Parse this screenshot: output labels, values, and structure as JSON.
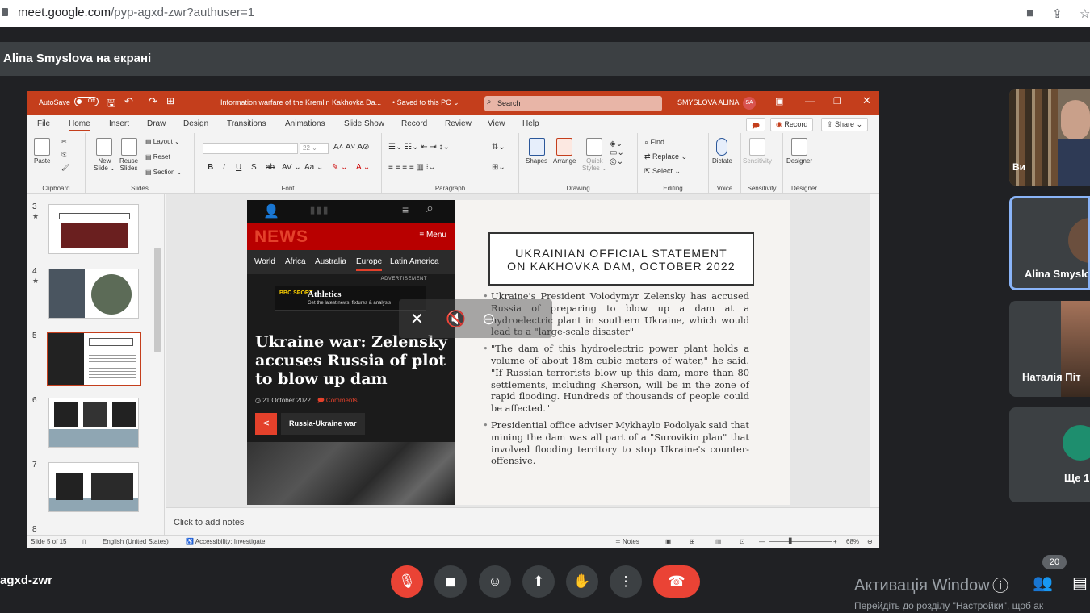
{
  "browser": {
    "url_host": "meet.google.com",
    "url_path": "/pyp-agxd-zwr?authuser=1"
  },
  "meet": {
    "presenter_banner": "Alina Smyslova на екрані",
    "meeting_code": "agxd-zwr",
    "participant_count": "20",
    "participants": [
      {
        "name": "Ви"
      },
      {
        "name": "Alina Smyslo"
      },
      {
        "name": "Наталія Піт"
      },
      {
        "name": "Ще 1"
      }
    ],
    "windows_activation_title": "Активація Window",
    "windows_activation_sub": "Перейдіть до розділу \"Настройки\", щоб ак"
  },
  "ppt": {
    "autosave_label": "AutoSave",
    "autosave_state": "Off",
    "doc_title": "Information warfare of the Kremlin Kakhovka Da...",
    "saved_state": "• Saved to this PC ⌄",
    "search_placeholder": "Search",
    "user_name": "SMYSLOVA ALINA",
    "user_initials": "SA",
    "tabs": [
      "File",
      "Home",
      "Insert",
      "Draw",
      "Design",
      "Transitions",
      "Animations",
      "Slide Show",
      "Record",
      "Review",
      "View",
      "Help"
    ],
    "record_button": "Record",
    "share_button": "Share",
    "ribbon": {
      "paste": "Paste",
      "clipboard": "Clipboard",
      "new_slide": "New",
      "new_slide2": "Slide ⌄",
      "reuse": "Reuse",
      "reuse2": "Slides",
      "layout": "Layout ⌄",
      "reset": "Reset",
      "section": "Section ⌄",
      "slides": "Slides",
      "font_size": "22",
      "font": "Font",
      "paragraph": "Paragraph",
      "shapes": "Shapes",
      "arrange": "Arrange",
      "quick_styles": "Quick",
      "quick_styles2": "Styles ⌄",
      "drawing": "Drawing",
      "find": "Find",
      "replace": "Replace ⌄",
      "select": "Select ⌄",
      "editing": "Editing",
      "dictate": "Dictate",
      "voice": "Voice",
      "sensitivity": "Sensitivity",
      "designer": "Designer"
    },
    "thumbnails": [
      {
        "num": "3",
        "star": "★"
      },
      {
        "num": "4",
        "star": "★"
      },
      {
        "num": "5",
        "star": ""
      },
      {
        "num": "6",
        "star": ""
      },
      {
        "num": "7",
        "star": ""
      },
      {
        "num": "8",
        "star": ""
      }
    ],
    "slide": {
      "bbc_news": "NEWS",
      "bbc_menu": "≡ Menu",
      "bbc_nav": [
        "World",
        "Africa",
        "Australia",
        "Europe",
        "Latin America"
      ],
      "bbc_ad": "ADVERTISEMENT",
      "bbc_sport_logo": "BBC SPORT",
      "bbc_sport_title": "Athletics",
      "bbc_sport_sub": "Get the latest news, fixtures & analysis",
      "headline": "Ukraine war: Zelensky accuses Russia of plot to blow up dam",
      "date": "◷ 21 October 2022",
      "comments": "Comments",
      "tag": "Russia-Ukraine war",
      "title_line1": "UKRAINIAN OFFICIAL STATEMENT",
      "title_line2": "ON KAKHOVKA DAM, OCTOBER 2022",
      "bullets": [
        "Ukraine's President Volodymyr Zelensky has accused Russia of preparing to blow up a dam at a hydroelectric plant in southern Ukraine, which would lead to a \"large-scale disaster\"",
        "\"The dam of this hydroelectric power plant holds a volume of about 18m cubic meters of water,\" he said. \"If Russian terrorists blow up this dam, more than 80 settlements, including Kherson, will be in the zone of rapid flooding. Hundreds of thousands of people could be affected.\"",
        "Presidential office adviser Mykhaylo Podolyak said that mining the dam was all part of a \"Surovikin plan\" that involved flooding territory to stop Ukraine's counter-offensive."
      ]
    },
    "notes_placeholder": "Click to add notes",
    "status": {
      "slide_count": "Slide 5 of 15",
      "language": "English (United States)",
      "accessibility": "Accessibility: Investigate",
      "notes": "Notes",
      "zoom": "68%"
    }
  },
  "colors": {
    "ppt_accent": "#c43e1c",
    "meet_red": "#ea4335",
    "meet_bg": "#202124"
  }
}
